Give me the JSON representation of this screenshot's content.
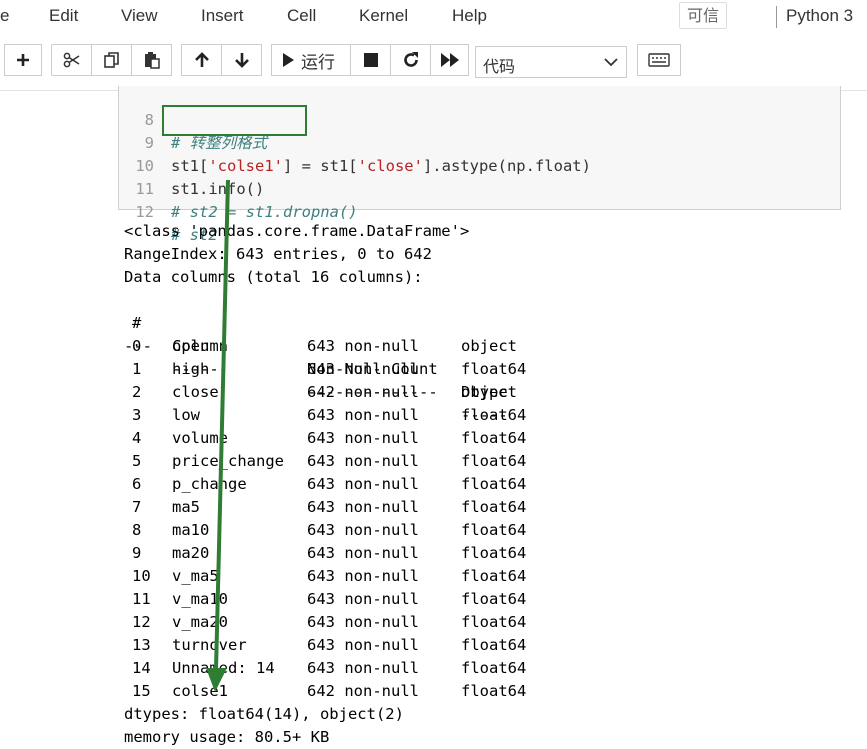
{
  "menubar": {
    "items": [
      "e",
      "Edit",
      "View",
      "Insert",
      "Cell",
      "Kernel",
      "Help"
    ],
    "trusted_label": "可信",
    "kernel_name": "Python 3"
  },
  "toolbar": {
    "buttons": [
      {
        "name": "insert-cell-below-button",
        "icon": "plus-icon"
      },
      {
        "name": "cut-cells-button",
        "icon": "scissors-icon"
      },
      {
        "name": "copy-cells-button",
        "icon": "copy-icon"
      },
      {
        "name": "paste-cells-button",
        "icon": "paste-icon"
      },
      {
        "name": "move-cell-up-button",
        "icon": "arrow-up-icon"
      },
      {
        "name": "move-cell-down-button",
        "icon": "arrow-down-icon"
      },
      {
        "name": "run-button",
        "icon": "play-icon",
        "label": "运行"
      },
      {
        "name": "interrupt-kernel-button",
        "icon": "stop-icon"
      },
      {
        "name": "restart-kernel-button",
        "icon": "refresh-icon"
      },
      {
        "name": "restart-run-all-button",
        "icon": "fast-forward-icon"
      },
      {
        "name": "command-palette-button",
        "icon": "keyboard-icon"
      }
    ],
    "run_label": "运行",
    "cell_type": "代码"
  },
  "cell": {
    "lines": [
      {
        "num": "8",
        "text": "# 转整列格式"
      },
      {
        "num": "9",
        "text": "st1['colse1'] = st1['close'].astype(np.float)"
      },
      {
        "num": "10",
        "text": "st1.info()"
      },
      {
        "num": "11",
        "text": "# st2 = st1.dropna()"
      },
      {
        "num": "12",
        "text": "# st2"
      }
    ],
    "line9_parts": {
      "a": "st1[",
      "b": "'colse1'",
      "c": "] = st1[",
      "d": "'close'",
      "e": "].astype(np.float)"
    }
  },
  "output": {
    "class_line": "<class 'pandas.core.frame.DataFrame'>",
    "range_index": "RangeIndex: 643 entries, 0 to 642",
    "data_columns": "Data columns (total 16 columns):",
    "header": {
      "idx": "#",
      "col": "Column",
      "nn": "Non-Null Count",
      "dt": "Dtype"
    },
    "dashes": {
      "idx": "---",
      "col": "------",
      "nn": "--------------",
      "dt": "-----"
    },
    "rows": [
      {
        "idx": "0",
        "col": "open",
        "nn": "643 non-null",
        "dt": "object"
      },
      {
        "idx": "1",
        "col": "high",
        "nn": "643 non-null",
        "dt": "float64"
      },
      {
        "idx": "2",
        "col": "close",
        "nn": "642 non-null",
        "dt": "object"
      },
      {
        "idx": "3",
        "col": "low",
        "nn": "643 non-null",
        "dt": "float64"
      },
      {
        "idx": "4",
        "col": "volume",
        "nn": "643 non-null",
        "dt": "float64"
      },
      {
        "idx": "5",
        "col": "price_change",
        "nn": "643 non-null",
        "dt": "float64"
      },
      {
        "idx": "6",
        "col": "p_change",
        "nn": "643 non-null",
        "dt": "float64"
      },
      {
        "idx": "7",
        "col": "ma5",
        "nn": "643 non-null",
        "dt": "float64"
      },
      {
        "idx": "8",
        "col": "ma10",
        "nn": "643 non-null",
        "dt": "float64"
      },
      {
        "idx": "9",
        "col": "ma20",
        "nn": "643 non-null",
        "dt": "float64"
      },
      {
        "idx": "10",
        "col": "v_ma5",
        "nn": "643 non-null",
        "dt": "float64"
      },
      {
        "idx": "11",
        "col": "v_ma10",
        "nn": "643 non-null",
        "dt": "float64"
      },
      {
        "idx": "12",
        "col": "v_ma20",
        "nn": "643 non-null",
        "dt": "float64"
      },
      {
        "idx": "13",
        "col": "turnover",
        "nn": "643 non-null",
        "dt": "float64"
      },
      {
        "idx": "14",
        "col": "Unnamed: 14",
        "nn": "643 non-null",
        "dt": "float64"
      },
      {
        "idx": "15",
        "col": "colse1",
        "nn": "642 non-null",
        "dt": "float64"
      }
    ],
    "dtypes": "dtypes: float64(14), object(2)",
    "memory": "memory usage: 80.5+ KB"
  },
  "colors": {
    "annotation_green": "#2e7d32",
    "comment": "#408080",
    "string": "#ba2121"
  }
}
